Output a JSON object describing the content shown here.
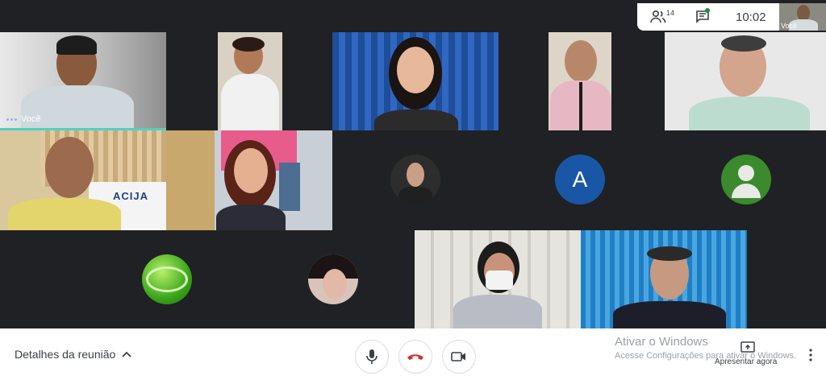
{
  "header": {
    "participants_count": "14",
    "time": "10:02",
    "self_preview_label": "Você"
  },
  "tiles": {
    "self_label": "Você",
    "avatar_letter": "A",
    "acija_logo_text": "ACIJA"
  },
  "footer": {
    "meeting_details": "Detalhes da reunião",
    "present_now": "Apresentar agora"
  },
  "watermark": {
    "title": "Ativar o Windows",
    "subtitle": "Acesse Configurações para ativar o Windows."
  },
  "colors": {
    "accent_blue": "#1a73e8",
    "hangup_red": "#d93025",
    "active_speaker": "#4fd1c5",
    "avatar_blue": "#1a56a6",
    "avatar_green": "#3b8a2e"
  },
  "icons": {
    "participants": "people-icon",
    "chat": "chat-icon",
    "mic": "mic-icon",
    "hangup": "hangup-icon",
    "camera": "camera-icon",
    "present": "present-icon",
    "more": "more-vert-icon"
  }
}
